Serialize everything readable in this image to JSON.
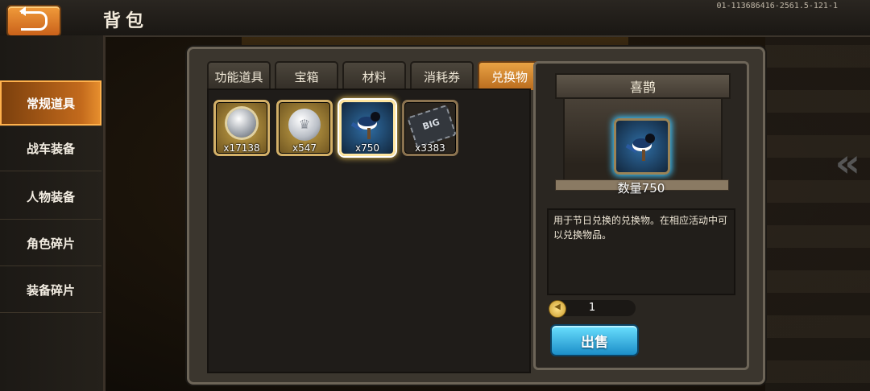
{
  "header": {
    "title": "背包",
    "version": "01-113686416-2561.5-121-1",
    "back_icon": "back-arrow-icon"
  },
  "sidebar": {
    "items": [
      {
        "label": "常规道具",
        "active": true
      },
      {
        "label": "战车装备",
        "active": false
      },
      {
        "label": "人物装备",
        "active": false
      },
      {
        "label": "角色碎片",
        "active": false
      },
      {
        "label": "装备碎片",
        "active": false
      }
    ]
  },
  "tabs": [
    {
      "label": "功能道具",
      "active": false
    },
    {
      "label": "宝箱",
      "active": false
    },
    {
      "label": "材料",
      "active": false
    },
    {
      "label": "消耗券",
      "active": false
    },
    {
      "label": "兑换物",
      "active": true
    }
  ],
  "items": [
    {
      "icon": "silver-medal-icon",
      "qty": "x17138"
    },
    {
      "icon": "silver-coin-icon",
      "qty": "x547"
    },
    {
      "icon": "magpie-icon",
      "qty": "x750",
      "selected": true
    },
    {
      "icon": "big-chip-icon",
      "qty": "x3383",
      "chip_text": "BIG"
    }
  ],
  "detail": {
    "name": "喜鹊",
    "quantity_label": "数量750",
    "description": "用于节日兑换的兑换物。在相应活动中可以兑换物品。",
    "sell_count": "1",
    "sell_button": "出售"
  }
}
